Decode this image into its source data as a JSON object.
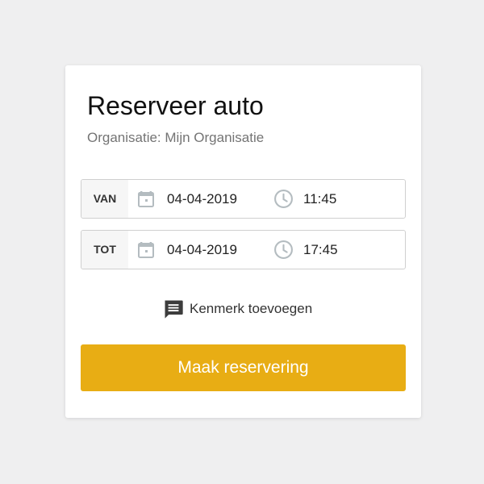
{
  "card": {
    "title": "Reserveer auto",
    "subtitle": "Organisatie: Mijn Organisatie"
  },
  "from": {
    "label": "VAN",
    "date": "04-04-2019",
    "time": "11:45",
    "date_icon": "calendar-icon",
    "time_icon": "clock-icon"
  },
  "to": {
    "label": "TOT",
    "date": "04-04-2019",
    "time": "17:45",
    "date_icon": "calendar-icon",
    "time_icon": "clock-icon"
  },
  "add_feature": {
    "label": "Kenmerk toevoegen",
    "icon": "comment-icon"
  },
  "submit": {
    "label": "Maak reservering"
  },
  "colors": {
    "accent": "#e8ad14",
    "background": "#efeff0",
    "icon_gray": "#b4bcc0"
  }
}
